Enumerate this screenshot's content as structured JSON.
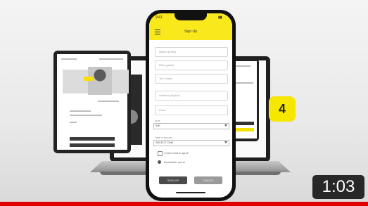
{
  "phone": {
    "time": "9:41",
    "status": "▮▮",
    "title": "Sign Up",
    "fields": [
      {
        "placeholder": "Name (prefix)"
      },
      {
        "placeholder": "Birth (prefix)"
      },
      {
        "placeholder": "Tel / email"
      },
      {
        "placeholder": "Address (region)"
      },
      {
        "placeholder": "Pass"
      }
    ],
    "select_label": "Area",
    "select_value": "IDE",
    "select2_label": "Type of account",
    "select2_value": "SELECT ONE",
    "checkbox_label": "I have read & agree",
    "radio_label": "Newsletter opt-in",
    "primary_button": "SIGN UP",
    "secondary_button": "CANCEL"
  },
  "step_badge": "4",
  "duration": "1:03",
  "progress": {
    "fraction": 1.0,
    "color": "#e00000"
  },
  "colors": {
    "accent": "#f8e81c",
    "badge": "#f6e600"
  },
  "icons": {
    "menu": "hamburger-icon"
  }
}
